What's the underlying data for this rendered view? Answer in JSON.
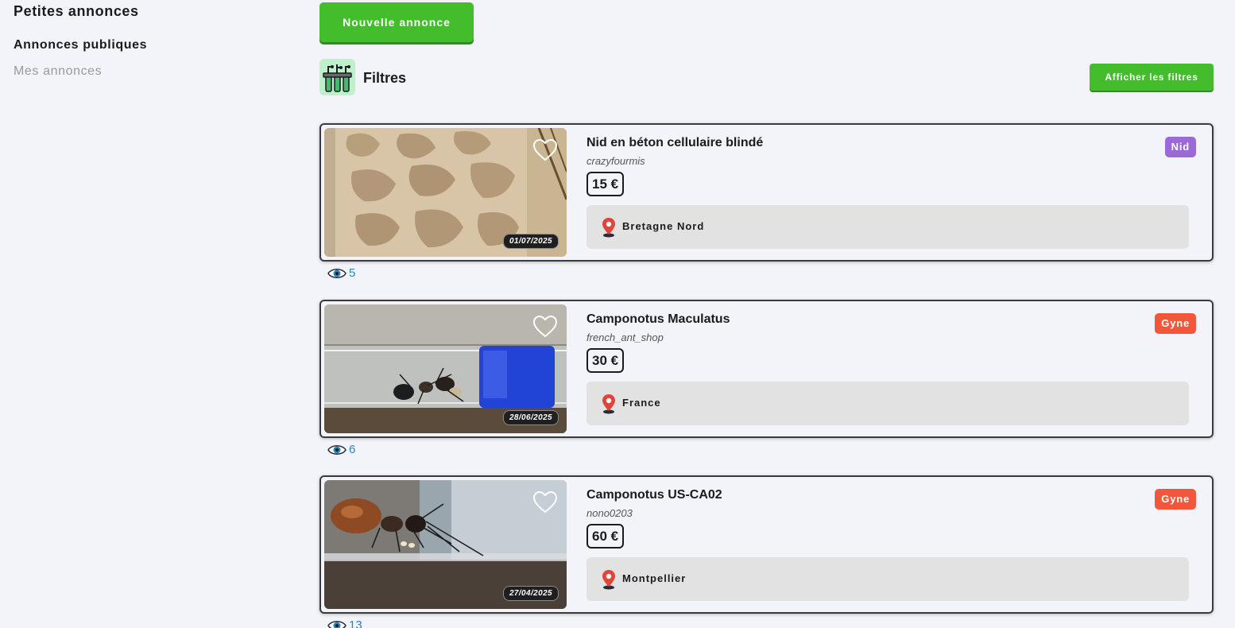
{
  "sidebar": {
    "title": "Petites annonces",
    "nav": [
      {
        "label": "Annonces publiques",
        "active": true
      },
      {
        "label": "Mes annonces",
        "active": false
      }
    ]
  },
  "header": {
    "new_button": "Nouvelle annonce",
    "filters_label": "Filtres",
    "filters_icon": "filter-tools-icon",
    "show_filters_button": "Afficher les filtres"
  },
  "colors": {
    "primary_green": "#43bd2b",
    "category_nid": "#9c6ad6",
    "category_gyne": "#f2573c",
    "views_blue": "#2a86b3",
    "location_pin": "#e0453a"
  },
  "listings": [
    {
      "title": "Nid en béton cellulaire blindé",
      "seller": "crazyfourmis",
      "price": "15 €",
      "location": "Bretagne Nord",
      "category": "Nid",
      "date": "01/07/2025",
      "views": "5"
    },
    {
      "title": "Camponotus Maculatus",
      "seller": "french_ant_shop",
      "price": "30 €",
      "location": "France",
      "category": "Gyne",
      "date": "28/06/2025",
      "views": "6"
    },
    {
      "title": "Camponotus US-CA02",
      "seller": "nono0203",
      "price": "60 €",
      "location": "Montpellier",
      "category": "Gyne",
      "date": "27/04/2025",
      "views": "13"
    }
  ]
}
